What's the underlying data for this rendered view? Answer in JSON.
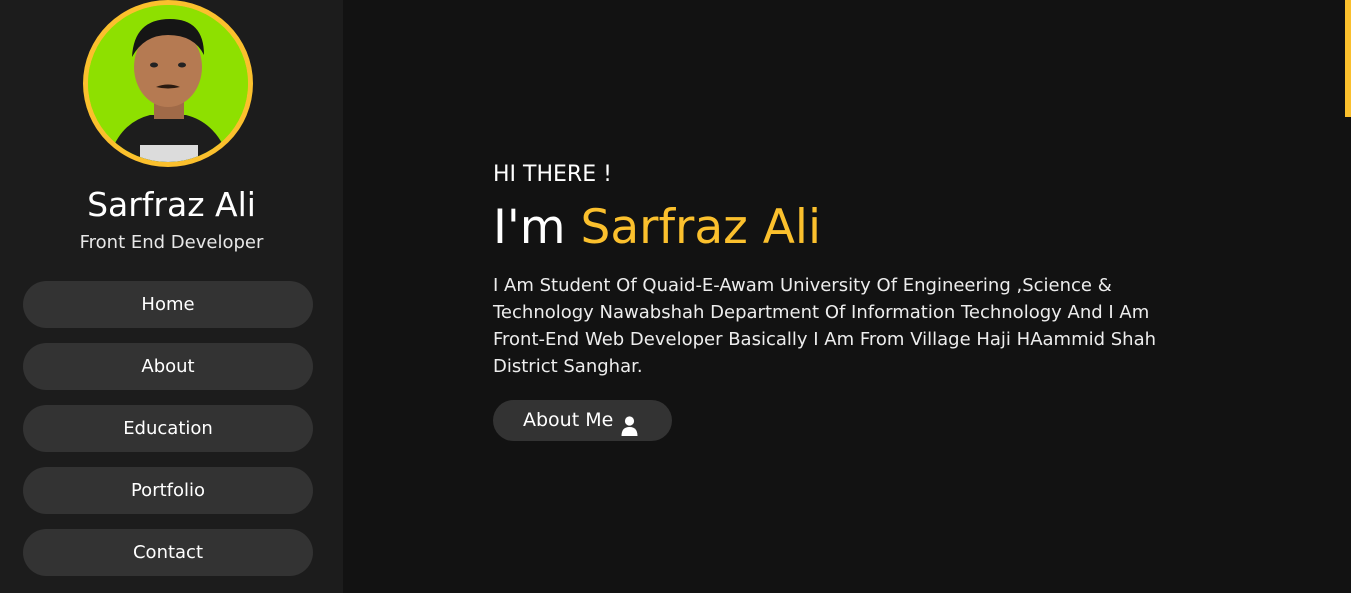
{
  "sidebar": {
    "profile_name": "Sarfraz Ali",
    "profile_role": "Front End Developer",
    "nav": [
      {
        "label": "Home"
      },
      {
        "label": "About"
      },
      {
        "label": "Education"
      },
      {
        "label": "Portfolio"
      },
      {
        "label": "Contact"
      }
    ]
  },
  "main": {
    "greeting": "HI THERE !",
    "intro_prefix": "I'm ",
    "intro_name": "Sarfraz Ali",
    "description": "I Am Student Of Quaid-E-Awam University Of Engineering ,Science & Technology Nawabshah Department Of Information Technology And I Am Front-End Web Developer Basically I Am From Village Haji HAammid Shah District Sanghar.",
    "about_button_label": "About Me",
    "about_button_icon": "user-icon"
  },
  "colors": {
    "accent": "#fbc02d",
    "sidebar_bg": "#1c1c1c",
    "main_bg": "#121212",
    "button_bg": "#333333"
  }
}
